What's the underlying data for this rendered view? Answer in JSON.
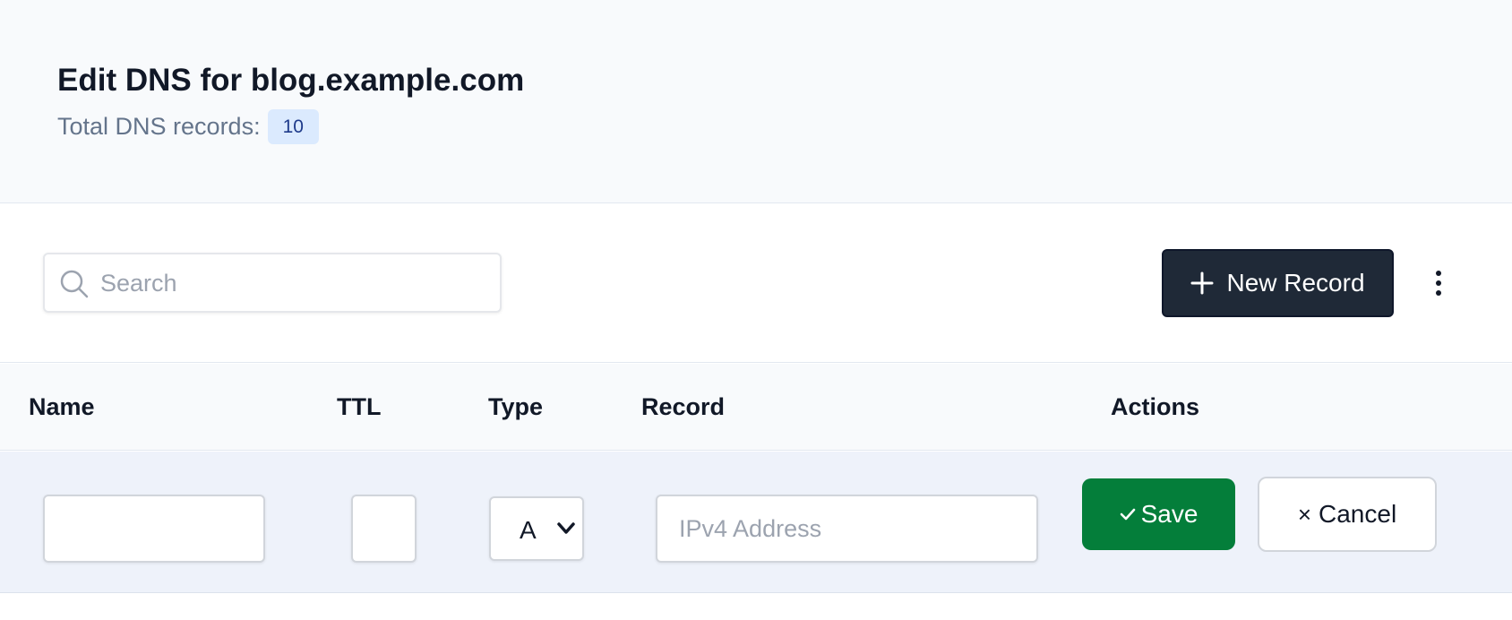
{
  "header": {
    "title": "Edit DNS for blog.example.com",
    "records_label": "Total DNS records:",
    "records_count": "10"
  },
  "toolbar": {
    "search_placeholder": "Search",
    "search_value": "",
    "search_icon": "search-icon",
    "new_record_label": "New Record",
    "new_record_icon": "plus-icon",
    "more_icon": "more-vertical-icon"
  },
  "table": {
    "columns": [
      "Name",
      "TTL",
      "Type",
      "Record",
      "Actions"
    ]
  },
  "edit_row": {
    "name_value": "",
    "ttl_value": "",
    "type_value": "A",
    "record_placeholder": "IPv4 Address",
    "record_value": "",
    "save_label": "Save",
    "save_icon": "check-icon",
    "cancel_label": "Cancel",
    "cancel_icon": "close-icon"
  },
  "colors": {
    "primary_button": "#1f2937",
    "save_button": "#047e3a",
    "badge_bg": "#dbeafe",
    "badge_text": "#1e3a8a",
    "edit_row_bg": "#eef2fa"
  }
}
